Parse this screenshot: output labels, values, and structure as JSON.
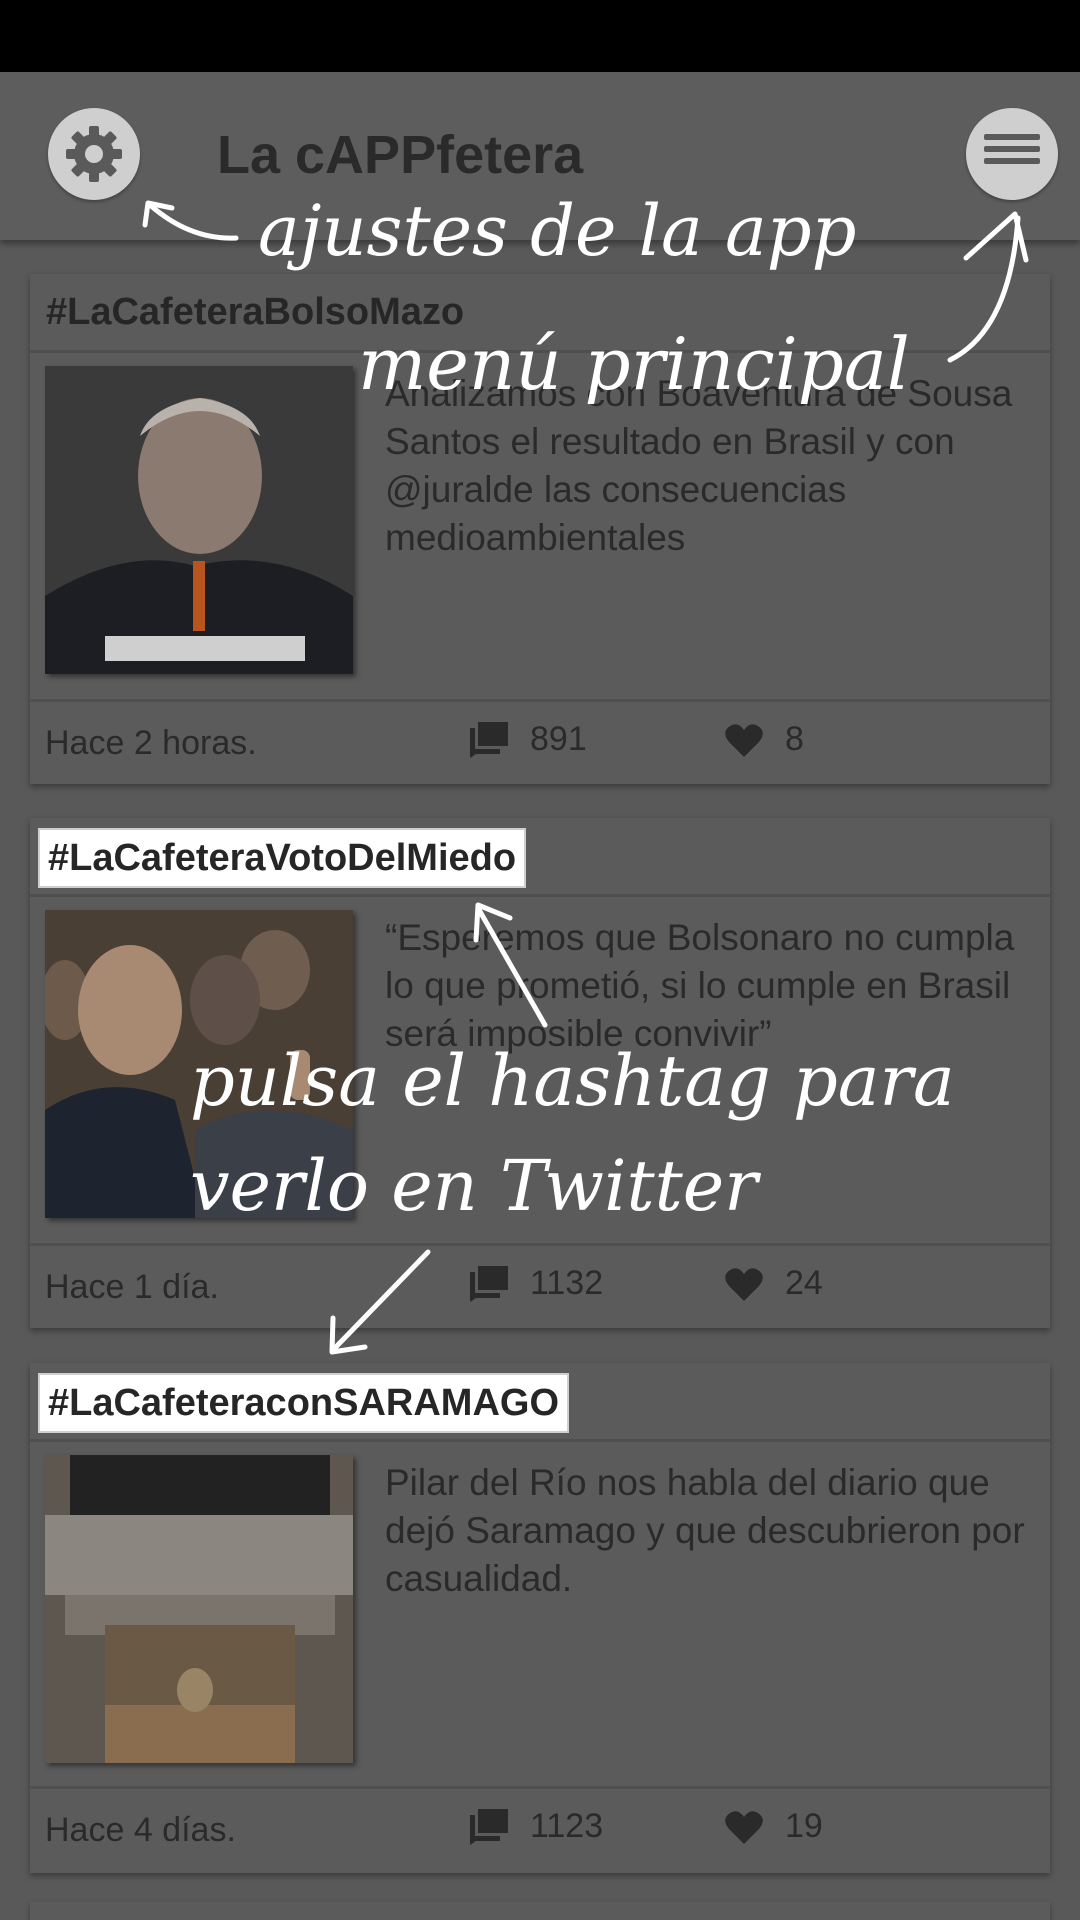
{
  "app": {
    "title": "La cAPPfetera"
  },
  "annotations": {
    "settings": "ajustes de la app",
    "menu": "menú principal",
    "hashtag_line1": "pulsa el hashtag para",
    "hashtag_line2": "verlo en Twitter"
  },
  "posts": [
    {
      "hashtag": "#LaCafeteraBolsoMazo",
      "summary": "Analizamos con Boaventura de Sousa Santos el resultado en Brasil y con @juralde las consecuencias medioambientales",
      "time": "Hace 2 horas.",
      "comments": "891",
      "likes": "8"
    },
    {
      "hashtag": "#LaCafeteraVotoDelMiedo",
      "summary": "“Esperemos que Bolsonaro no cumpla lo que prometió, si lo cumple en Brasil será imposible convivir”",
      "time": "Hace 1 día.",
      "comments": "1132",
      "likes": "24"
    },
    {
      "hashtag": "#LaCafeteraconSARAMAGO",
      "summary": "Pilar del Río nos habla del diario que dejó Saramago y que descubrieron por casualidad.",
      "time": "Hace 4 días.",
      "comments": "1123",
      "likes": "19"
    }
  ]
}
